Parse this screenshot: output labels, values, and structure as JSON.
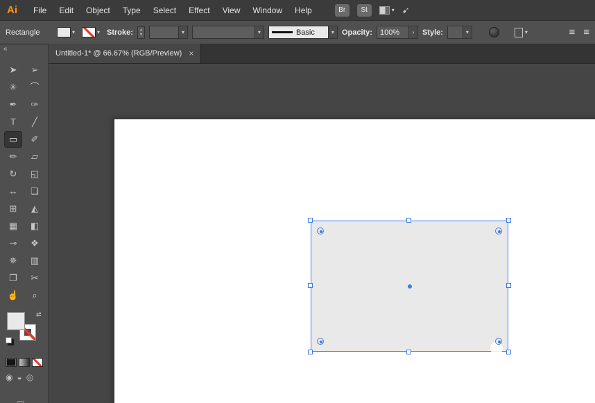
{
  "colors": {
    "accent": "#3e7ce2",
    "logo_orange": "#f7931e",
    "menubar_bg": "#3b3b3b",
    "controlbar_bg": "#505050",
    "panel_bg": "#4f4f4f",
    "canvas_bg": "#454545",
    "artboard": "#ffffff",
    "shape_fill": "#e9e9e9",
    "stroke_none_red": "#e23a2e"
  },
  "menubar": {
    "logo": "Ai",
    "items": [
      "File",
      "Edit",
      "Object",
      "Type",
      "Select",
      "Effect",
      "View",
      "Window",
      "Help"
    ],
    "bridge_label": "Br",
    "stock_label": "St",
    "caret": "▾",
    "gpu_glyph": "➹"
  },
  "controlbar": {
    "context_label": "Rectangle",
    "caret": "▾",
    "stroke_label": "Stroke:",
    "stepper_up": "▲",
    "stepper_down": "▼",
    "stroke_width_value": "",
    "brush_name": "Basic",
    "opacity_label": "Opacity:",
    "opacity_value": "100%",
    "opacity_chevron": "›",
    "style_label": "Style:",
    "align_glyph": "≡"
  },
  "docarea": {
    "tab_title": "Untitled-1* @ 66.67% (RGB/Preview)",
    "tab_close": "×"
  },
  "toolbar": {
    "collapse_glyph": "«",
    "swap_glyph": "⇄",
    "tools": [
      {
        "name": "selection-tool",
        "glyph": "➤"
      },
      {
        "name": "direct-selection-tool",
        "glyph": "➢"
      },
      {
        "name": "magic-wand-tool",
        "glyph": "✳"
      },
      {
        "name": "lasso-tool",
        "glyph": "⌒"
      },
      {
        "name": "pen-tool",
        "glyph": "✒"
      },
      {
        "name": "curvature-tool",
        "glyph": "✑"
      },
      {
        "name": "type-tool",
        "glyph": "T"
      },
      {
        "name": "line-segment-tool",
        "glyph": "╱"
      },
      {
        "name": "rectangle-tool",
        "glyph": "▭",
        "selected": true
      },
      {
        "name": "paintbrush-tool",
        "glyph": "✐"
      },
      {
        "name": "shaper-tool",
        "glyph": "✏"
      },
      {
        "name": "eraser-tool",
        "glyph": "▱"
      },
      {
        "name": "rotate-tool",
        "glyph": "↻"
      },
      {
        "name": "scale-tool",
        "glyph": "◱"
      },
      {
        "name": "width-tool",
        "glyph": "↔"
      },
      {
        "name": "free-transform-tool",
        "glyph": "❏"
      },
      {
        "name": "shape-builder-tool",
        "glyph": "⊞"
      },
      {
        "name": "perspective-grid-tool",
        "glyph": "◭"
      },
      {
        "name": "mesh-tool",
        "glyph": "▦"
      },
      {
        "name": "gradient-tool",
        "glyph": "◧"
      },
      {
        "name": "eyedropper-tool",
        "glyph": "⊸"
      },
      {
        "name": "blend-tool",
        "glyph": "❖"
      },
      {
        "name": "symbol-sprayer-tool",
        "glyph": "✵"
      },
      {
        "name": "column-graph-tool",
        "glyph": "▥"
      },
      {
        "name": "artboard-tool",
        "glyph": "❐"
      },
      {
        "name": "slice-tool",
        "glyph": "✂"
      },
      {
        "name": "hand-tool",
        "glyph": "☝"
      },
      {
        "name": "zoom-tool",
        "glyph": "⌕"
      }
    ],
    "drawing_modes": [
      {
        "name": "draw-normal-mode",
        "glyph": "◉"
      },
      {
        "name": "draw-behind-mode",
        "glyph": "◒"
      },
      {
        "name": "draw-inside-mode",
        "glyph": "◎"
      }
    ],
    "screen_mode_glyph": "▭"
  }
}
